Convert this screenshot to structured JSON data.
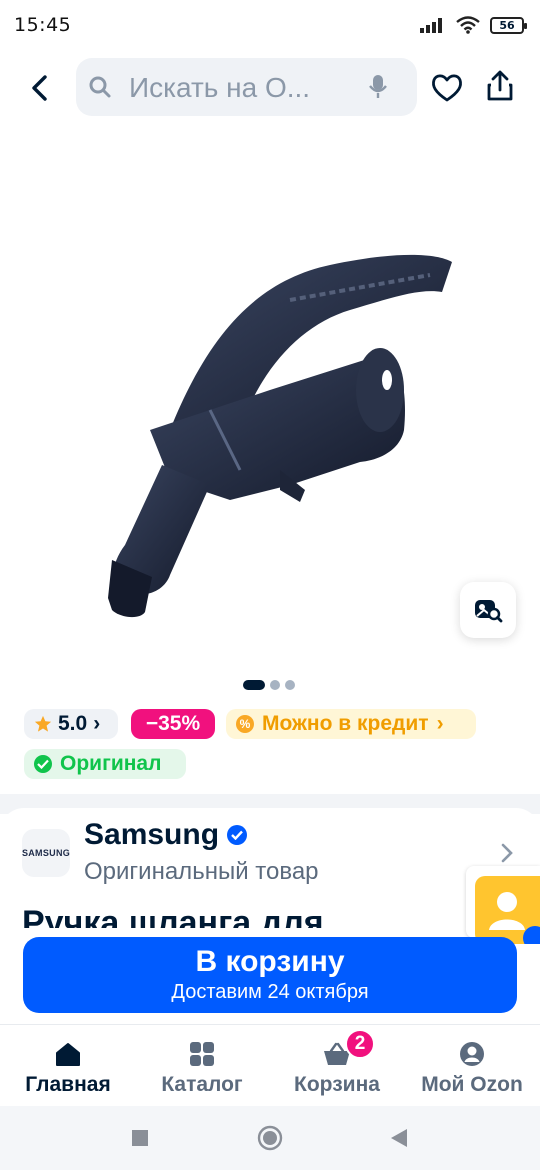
{
  "status_bar": {
    "time": "15:45",
    "battery": "56"
  },
  "search": {
    "placeholder": "Искать на О..."
  },
  "icons": {
    "back": "chevron-left-icon",
    "search": "search-icon",
    "mic": "microphone-icon",
    "favorite": "heart-icon",
    "share": "share-icon",
    "image_search": "image-search-icon"
  },
  "gallery": {
    "slides": 3,
    "active_slide": 1
  },
  "badges": {
    "rating": "5.0",
    "rating_arrow": "›",
    "discount": "−35%",
    "credit": "Можно в кредит",
    "credit_arrow": "›",
    "credit_icon": "%",
    "original": "Оригинал"
  },
  "seller": {
    "logo_text": "SAMSUNG",
    "name": "Samsung",
    "subtitle": "Оригинальный товар"
  },
  "product": {
    "title": "Ручка шланга для"
  },
  "cart_button": {
    "label": "В корзину",
    "delivery": "Доставим 24 октября"
  },
  "tabs": [
    {
      "label": "Главная",
      "active": true
    },
    {
      "label": "Каталог",
      "active": false
    },
    {
      "label": "Корзина",
      "active": false,
      "badge": "2"
    },
    {
      "label": "Мой Ozon",
      "active": false
    }
  ],
  "colors": {
    "brand_blue": "#005bff",
    "discount_pink": "#f1117e",
    "credit_orange": "#f09d00",
    "original_green": "#10c44c",
    "text_primary": "#001a34"
  }
}
